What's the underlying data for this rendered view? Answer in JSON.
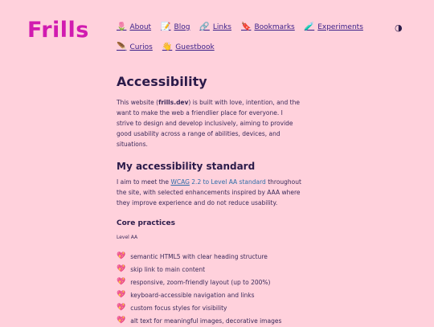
{
  "site": {
    "logo": "Frills"
  },
  "nav": {
    "row1": [
      {
        "icon": "🌷",
        "label": "About"
      },
      {
        "icon": "📝",
        "label": "Blog"
      },
      {
        "icon": "🔗",
        "label": "Links"
      },
      {
        "icon": "🔖",
        "label": "Bookmarks"
      },
      {
        "icon": "🧪",
        "label": "Experiments"
      }
    ],
    "row2": [
      {
        "icon": "🪶",
        "label": "Curios"
      },
      {
        "icon": "👋",
        "label": "Guestbook"
      }
    ],
    "theme_toggle": "◑"
  },
  "page": {
    "title": "Accessibility",
    "intro_pre": "This website (",
    "intro_bold": "frills.dev",
    "intro_post": ") is built with love, intention, and the want to make the web a friendlier place for everyone. I strive to design and develop inclusively, aiming to provide good usability across a range of abilities, devices, and situations."
  },
  "standard": {
    "heading": "My accessibility standard",
    "text_pre": "I aim to meet the ",
    "link_abbr": "WCAG",
    "link_text": " 2.2 to Level AA standard",
    "text_post": " throughout the site, with selected enhancements inspired by AAA where they improve experience and do not reduce usability."
  },
  "core": {
    "heading": "Core practices",
    "level": "Level AA",
    "items": [
      "semantic HTML5 with clear heading structure",
      "skip link to main content",
      "responsive, zoom-friendly layout (up to 200%)",
      "keyboard-accessible navigation and links",
      "custom focus styles for visibility",
      "alt text for meaningful images, decorative images"
    ]
  }
}
